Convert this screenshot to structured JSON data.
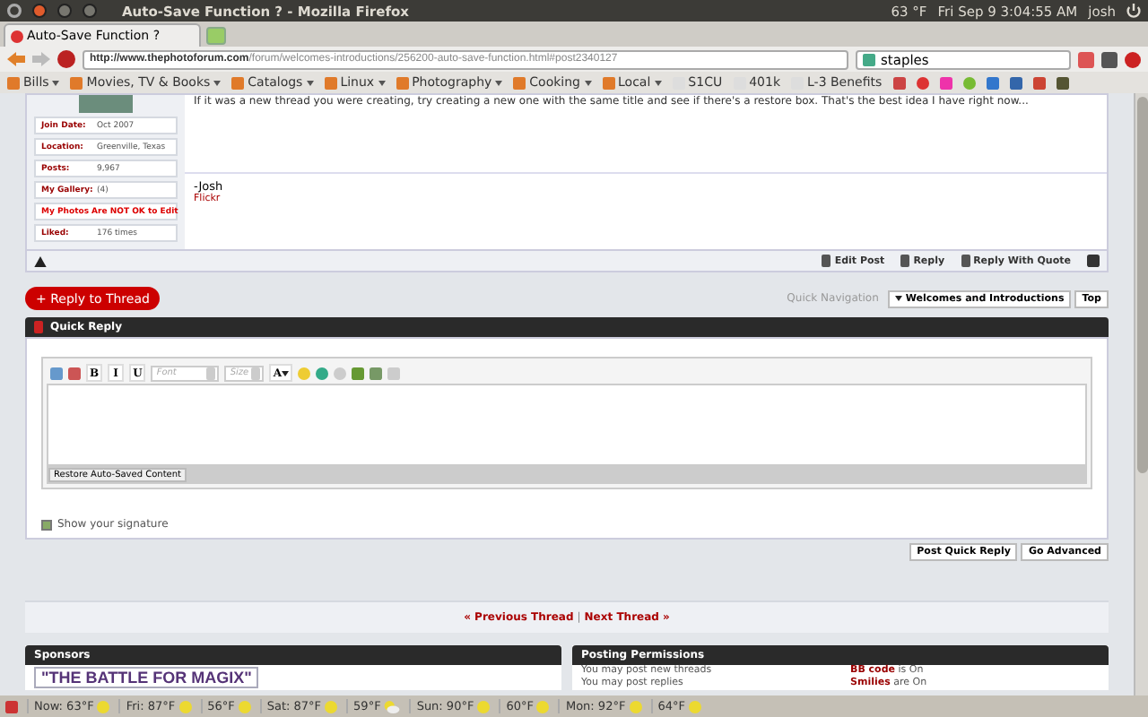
{
  "panel": {
    "title": "Auto-Save Function ? - Mozilla Firefox",
    "temperature": "63 °F",
    "clock": "Fri Sep 9  3:04:55 AM",
    "user": "josh"
  },
  "browser": {
    "tabs": [
      {
        "label": "Auto-Save Function ?",
        "selected": true
      }
    ],
    "url_host": "http://www.thephotoforum.com",
    "url_path": "/forum/welcomes-introductions/256200-auto-save-function.html#post2340127",
    "search": "staples",
    "bookmarks": [
      {
        "label": "Bills",
        "kind": "folder"
      },
      {
        "label": "Movies, TV & Books",
        "kind": "folder"
      },
      {
        "label": "Catalogs",
        "kind": "folder"
      },
      {
        "label": "Linux",
        "kind": "folder"
      },
      {
        "label": "Photography",
        "kind": "folder"
      },
      {
        "label": "Cooking",
        "kind": "folder"
      },
      {
        "label": "Local",
        "kind": "folder"
      },
      {
        "label": "S1CU",
        "kind": "page"
      },
      {
        "label": "401k",
        "kind": "page"
      },
      {
        "label": "L-3 Benefits",
        "kind": "page"
      }
    ]
  },
  "post": {
    "profile": [
      {
        "label": "Join Date:",
        "value": "Oct 2007"
      },
      {
        "label": "Location:",
        "value": "Greenville, Texas"
      },
      {
        "label": "Posts:",
        "value": "9,967"
      },
      {
        "label": "My Gallery:",
        "value": "(4)"
      },
      {
        "label": "My Photos Are NOT OK to Edit"
      },
      {
        "label": "Liked:",
        "value": "176 times"
      }
    ],
    "message": "If it was a new thread you were creating, try creating a new one with the same title and see if there's a restore box. That's the best idea I have right now...",
    "signature": "-Josh",
    "signature_link": "Flickr",
    "actions": [
      "Edit Post",
      "Reply",
      "Reply With Quote"
    ]
  },
  "reply_button": "+ Reply to Thread",
  "quick_navigation": {
    "label": "Quick Navigation",
    "forum": "Welcomes and Introductions",
    "top": "Top"
  },
  "quick_reply": {
    "title": "Quick Reply",
    "format_letters": [
      "B",
      "I",
      "U"
    ],
    "font_placeholder": "Font",
    "size_placeholder": "Size",
    "color_letter": "A",
    "restore": "Restore Auto-Saved Content",
    "show_signature": {
      "label": "Show your signature",
      "checked": true
    },
    "buttons": [
      "Post Quick Reply",
      "Go Advanced"
    ]
  },
  "thread_nav": {
    "previous": "« Previous Thread",
    "separator": "|",
    "next": "Next Thread »"
  },
  "sponsors": {
    "title": "Sponsors",
    "ad": "\"THE BATTLE FOR MAGIX\""
  },
  "permissions": {
    "title": "Posting Permissions",
    "rules": [
      {
        "text": "You may post new threads",
        "term": "BB code",
        "state": "is On"
      },
      {
        "text": "You may post replies",
        "term": "Smilies",
        "state": "are On"
      }
    ]
  },
  "weather": [
    {
      "text": "Now: 63°F",
      "kind": "sun"
    },
    {
      "text": "Fri: 87°F",
      "kind": "sun"
    },
    {
      "text": "56°F",
      "kind": "sun"
    },
    {
      "text": "Sat: 87°F",
      "kind": "sun"
    },
    {
      "text": "59°F",
      "kind": "cloud"
    },
    {
      "text": "Sun: 90°F",
      "kind": "sun"
    },
    {
      "text": "60°F",
      "kind": "sun"
    },
    {
      "text": "Mon: 92°F",
      "kind": "sun"
    },
    {
      "text": "64°F",
      "kind": "sun"
    }
  ]
}
